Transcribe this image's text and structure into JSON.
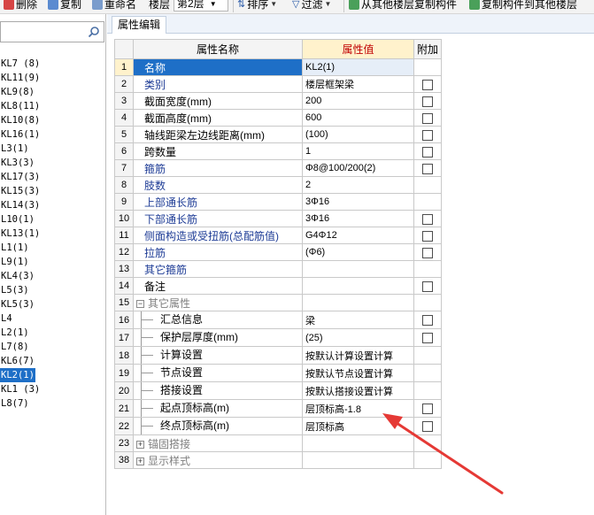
{
  "toolbar": {
    "delete_label": "删除",
    "copy_label": "复制",
    "rename_label": "重命名",
    "floor_label": "楼层",
    "floor_value": "第2层",
    "sort_label": "排序",
    "filter_label": "过滤",
    "copy_from_floor_label": "从其他楼层复制构件",
    "copy_to_floor_label": "复制构件到其他楼层"
  },
  "search": {
    "placeholder": "",
    "value": ""
  },
  "member_list": [
    "KL7 (8)",
    "KL11(9)",
    "KL9(8)",
    "KL8(11)",
    "KL10(8)",
    "KL16(1)",
    "L3(1)",
    "KL3(3)",
    "KL17(3)",
    "KL15(3)",
    "KL14(3)",
    "L10(1)",
    "KL13(1)",
    "L1(1)",
    "L9(1)",
    "KL4(3)",
    "L5(3)",
    "KL5(3)",
    "L4",
    "L2(1)",
    "L7(8)",
    "KL6(7)",
    "KL2(1)",
    "KL1 (3)",
    "L8(7)"
  ],
  "tab": {
    "label": "属性编辑"
  },
  "grid": {
    "headers": {
      "name": "属性名称",
      "value": "属性值",
      "extra": "附加"
    },
    "rows": [
      {
        "num": "1",
        "name": "名称",
        "value": "KL2(1)"
      },
      {
        "num": "2",
        "name": "类别",
        "value": "楼层框架梁"
      },
      {
        "num": "3",
        "name": "截面宽度(mm)",
        "value": "200"
      },
      {
        "num": "4",
        "name": "截面高度(mm)",
        "value": "600"
      },
      {
        "num": "5",
        "name": "轴线距梁左边线距离(mm)",
        "value": "(100)"
      },
      {
        "num": "6",
        "name": "跨数量",
        "value": "1"
      },
      {
        "num": "7",
        "name": "箍筋",
        "value": "Φ8@100/200(2)"
      },
      {
        "num": "8",
        "name": "肢数",
        "value": "2"
      },
      {
        "num": "9",
        "name": "上部通长筋",
        "value": "3Φ16"
      },
      {
        "num": "10",
        "name": "下部通长筋",
        "value": "3Φ16"
      },
      {
        "num": "11",
        "name": "侧面构造或受扭筋(总配筋值)",
        "value": "G4Φ12"
      },
      {
        "num": "12",
        "name": "拉筋",
        "value": "(Φ6)"
      },
      {
        "num": "13",
        "name": "其它箍筋",
        "value": ""
      },
      {
        "num": "14",
        "name": "备注",
        "value": ""
      },
      {
        "num": "15",
        "name": "其它属性",
        "value": ""
      },
      {
        "num": "16",
        "name": "汇总信息",
        "value": "梁"
      },
      {
        "num": "17",
        "name": "保护层厚度(mm)",
        "value": "(25)"
      },
      {
        "num": "18",
        "name": "计算设置",
        "value": "按默认计算设置计算"
      },
      {
        "num": "19",
        "name": "节点设置",
        "value": "按默认节点设置计算"
      },
      {
        "num": "20",
        "name": "搭接设置",
        "value": "按默认搭接设置计算"
      },
      {
        "num": "21",
        "name": "起点顶标高(m)",
        "value": "层顶标高-1.8"
      },
      {
        "num": "22",
        "name": "终点顶标高(m)",
        "value": "层顶标高"
      },
      {
        "num": "23",
        "name": "锚固搭接",
        "value": ""
      },
      {
        "num": "38",
        "name": "显示样式",
        "value": ""
      }
    ]
  },
  "colors": {
    "accent_selected": "#1e6fc7",
    "header_value_bg": "#fff2cc",
    "header_value_text": "#c00000",
    "blue_property_text": "#1e3c96",
    "annotation_arrow": "#e53935"
  }
}
